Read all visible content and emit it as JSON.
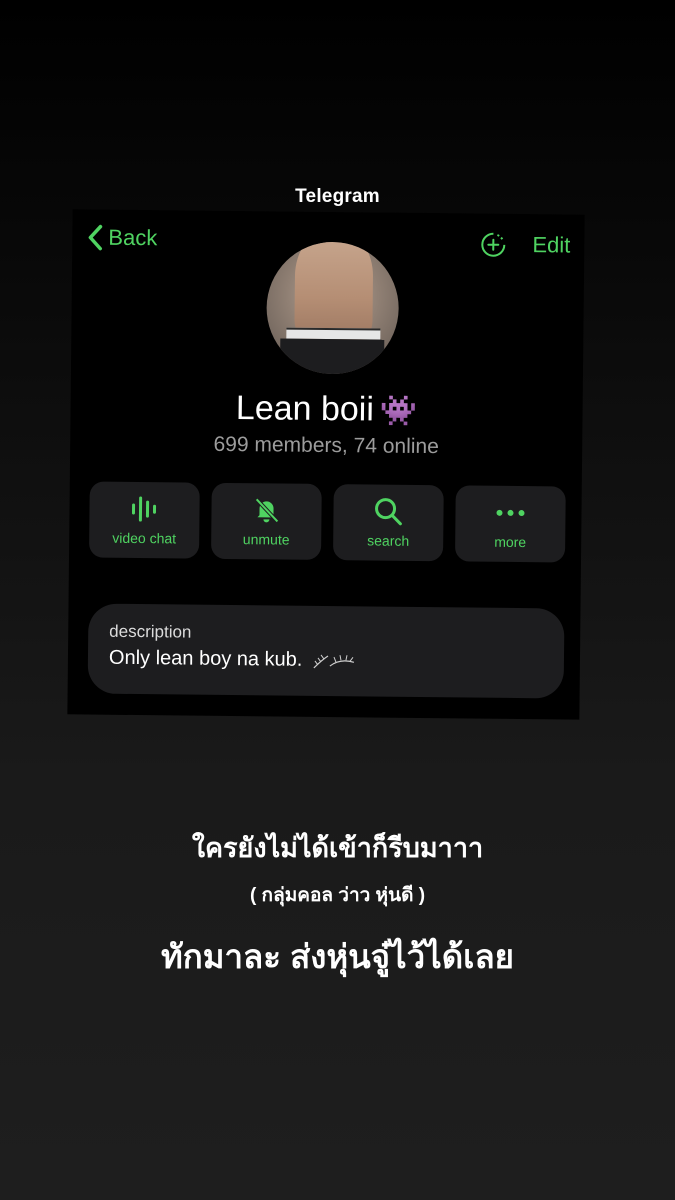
{
  "story": {
    "app_label": "Telegram",
    "caption_line1": "ใครยังไม่ได้เข้าก็รีบมาาา",
    "caption_line2": "( กลุ่มคอล ว่าว หุ่นดี )",
    "caption_line3": "ทักมาละ ส่งหุ่นจู๋ไว้ได้เลย"
  },
  "screen": {
    "nav": {
      "back_label": "Back",
      "edit_label": "Edit",
      "back_icon": "chevron-left-icon",
      "add_icon": "add-circle-icon"
    },
    "group": {
      "name": "Lean boii",
      "emoji": "👾",
      "meta": "699 members, 74 online"
    },
    "actions": [
      {
        "label": "video chat",
        "icon": "voice-bars-icon"
      },
      {
        "label": "unmute",
        "icon": "bell-slash-icon"
      },
      {
        "label": "search",
        "icon": "search-icon"
      },
      {
        "label": "more",
        "icon": "more-dots-icon"
      }
    ],
    "description": {
      "label": "description",
      "text": "Only lean boy na kub."
    }
  },
  "colors": {
    "accent": "#4fd361",
    "card_bg": "#000000",
    "tile_bg": "#1d1d1f",
    "meta_text": "#9c9c9c"
  }
}
